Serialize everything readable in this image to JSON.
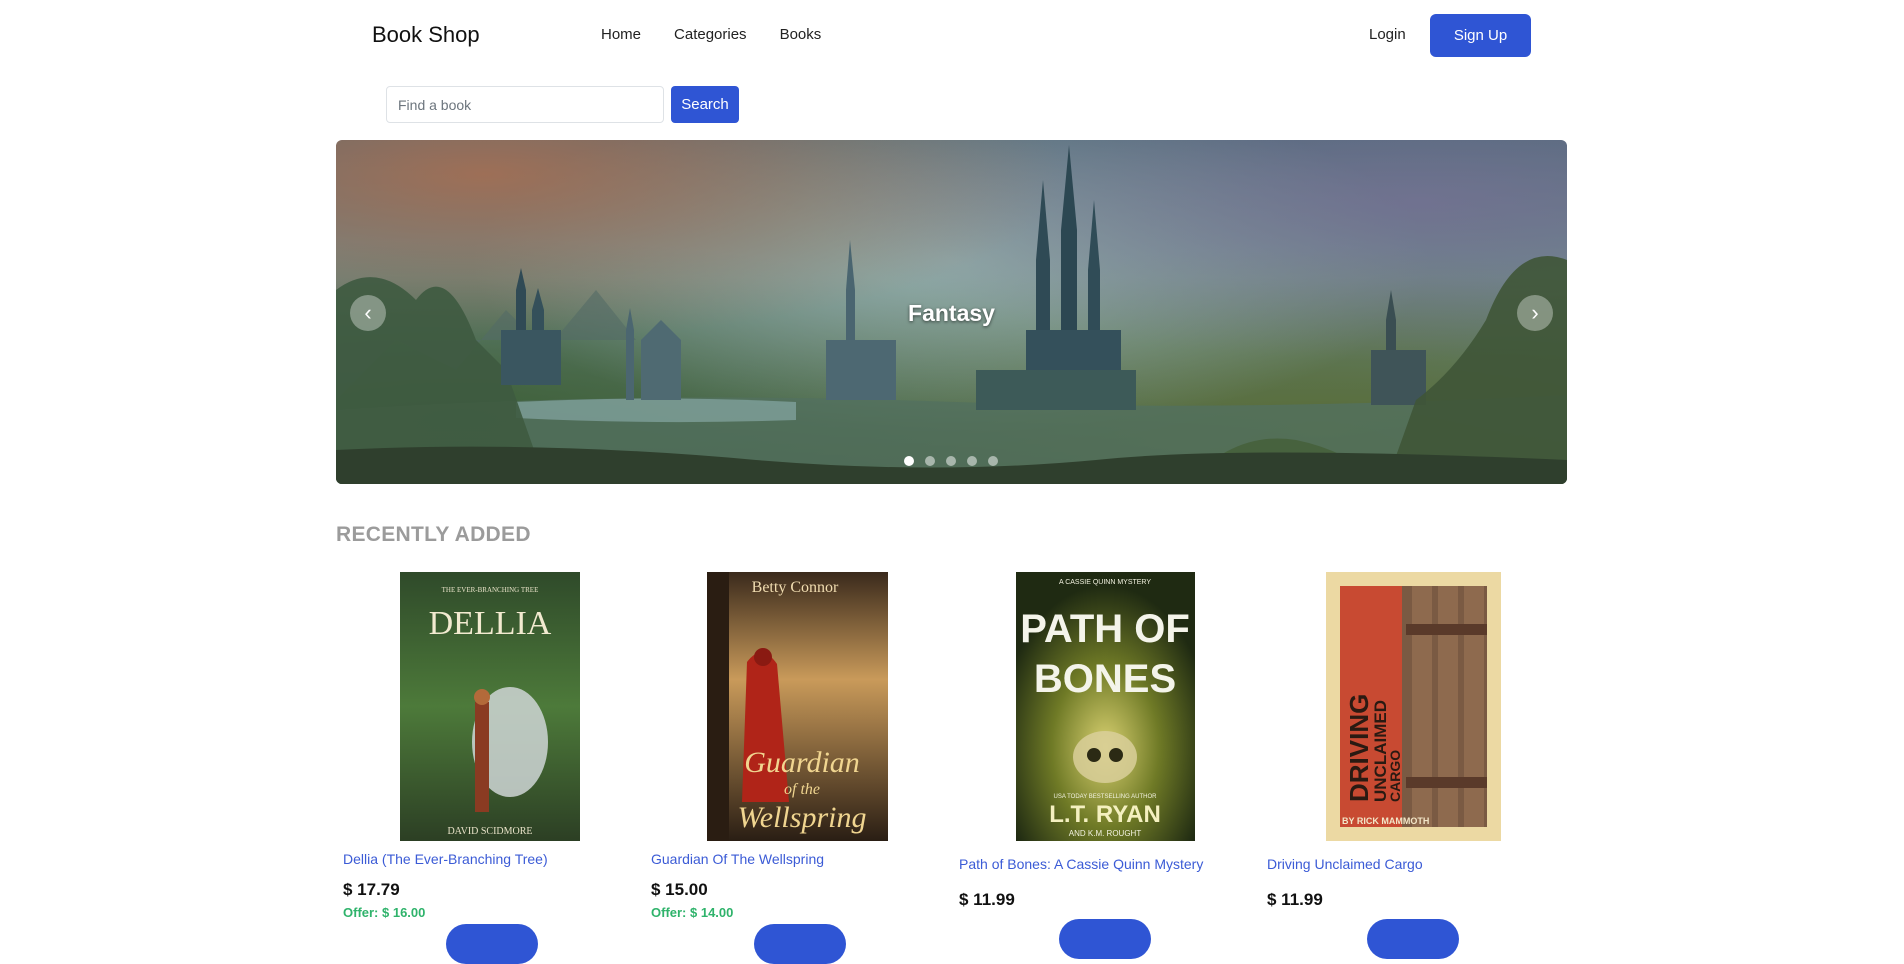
{
  "brand": "Book Shop",
  "nav": {
    "links": [
      "Home",
      "Categories",
      "Books"
    ],
    "login": "Login",
    "signup": "Sign Up"
  },
  "search": {
    "placeholder": "Find a book",
    "button": "Search"
  },
  "carousel": {
    "caption": "Fantasy",
    "slides": 5,
    "active_slide": 1
  },
  "section_title": "RECENTLY ADDED",
  "books": [
    {
      "title": "Dellia (The Ever-Branching Tree)",
      "price": "$ 17.79",
      "offer": "Offer: $ 16.00",
      "cover": {
        "series": "THE EVER-BRANCHING TREE",
        "heading": "DELLIA",
        "author": "DAVID SCIDMORE"
      }
    },
    {
      "title": "Guardian Of The Wellspring",
      "price": "$ 15.00",
      "offer": "Offer: $ 14.00",
      "cover": {
        "author": "Betty Connor",
        "line1": "Guardian",
        "line2": "of the",
        "line3": "Wellspring"
      }
    },
    {
      "title": "Path of Bones: A Cassie Quinn Mystery",
      "price": "$ 11.99",
      "offer": "",
      "cover": {
        "series": "A CASSIE QUINN MYSTERY",
        "line1": "PATH OF",
        "line2": "BONES",
        "tagline": "USA TODAY BESTSELLING AUTHOR",
        "author": "L.T. RYAN",
        "coauthor": "AND K.M. ROUGHT"
      }
    },
    {
      "title": "Driving Unclaimed Cargo",
      "price": "$ 11.99",
      "offer": "",
      "cover": {
        "line1": "DRIVING",
        "line2": "UNCLAIMED",
        "line3": "CARGO",
        "author": "BY RICK MAMMOTH"
      }
    }
  ]
}
